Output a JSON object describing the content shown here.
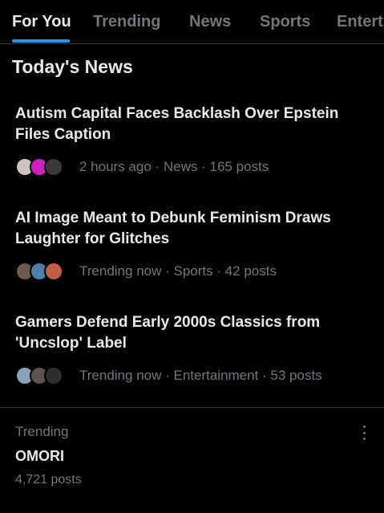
{
  "tabs": [
    {
      "label": "For You",
      "active": true
    },
    {
      "label": "Trending",
      "active": false
    },
    {
      "label": "News",
      "active": false
    },
    {
      "label": "Sports",
      "active": false
    },
    {
      "label": "Entert",
      "active": false
    }
  ],
  "section_title": "Today's News",
  "stories": [
    {
      "title": "Autism Capital Faces Backlash Over Epstein Files Caption",
      "meta": "2 hours ago · News · 165 posts",
      "avatar_colors": [
        "#c9c4bf",
        "#d01fbf",
        "#3a3a3a"
      ]
    },
    {
      "title": "AI Image Meant to Debunk Feminism Draws Laughter for Glitches",
      "meta": "Trending now · Sports · 42 posts",
      "avatar_colors": [
        "#6a5b4e",
        "#4f7fa8",
        "#c45c4a"
      ]
    },
    {
      "title": "Gamers Defend Early 2000s Classics from 'Uncslop' Label",
      "meta": "Trending now · Entertainment · 53 posts",
      "avatar_colors": [
        "#8aa0b5",
        "#5b5450",
        "#2e2e2e"
      ]
    }
  ],
  "trend": {
    "label": "Trending",
    "name": "OMORI",
    "count": "4,721 posts"
  },
  "colors": {
    "background": "#000000",
    "text_primary": "#e7e9ea",
    "text_secondary": "#71767b",
    "accent": "#1d9bf0",
    "divider": "#2f3336"
  }
}
